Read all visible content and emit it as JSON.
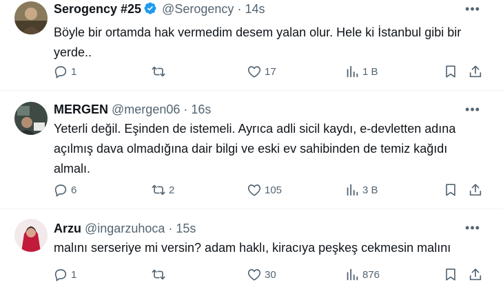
{
  "tweets": [
    {
      "name": "Serogency #25",
      "verified": true,
      "handle": "@Serogency",
      "time": "14s",
      "text": "Böyle bir ortamda hak vermedim desem yalan olur. Hele ki İstanbul gibi bir yerde..",
      "replies": "1",
      "retweets": "",
      "likes": "17",
      "views": "1 B"
    },
    {
      "name": "MERGEN",
      "verified": false,
      "handle": "@mergen06",
      "time": "16s",
      "text": "Yeterli değil. Eşinden de istemeli. Ayrıca adli sicil kaydı, e-devletten adına açılmış dava olmadığına dair bilgi ve eski ev sahibinden de temiz kağıdı almalı.",
      "replies": "6",
      "retweets": "2",
      "likes": "105",
      "views": "3 B"
    },
    {
      "name": "Arzu",
      "verified": false,
      "handle": "@ingarzuhoca",
      "time": "15s",
      "text": "malını serseriye mi versin? adam haklı, kiracıya peşkeş cekmesin malını",
      "replies": "1",
      "retweets": "",
      "likes": "30",
      "views": "876"
    }
  ],
  "separator": "·",
  "more_glyph": "•••",
  "colors": {
    "text": "#0f1419",
    "secondary": "#536471",
    "verified": "#1d9bf0",
    "divider": "#eff3f4"
  }
}
